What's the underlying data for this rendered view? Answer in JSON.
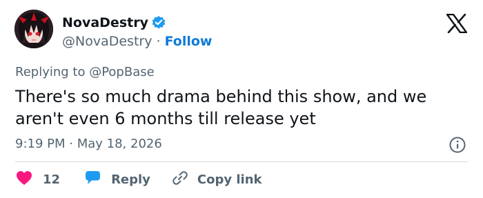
{
  "user": {
    "display_name": "NovaDestry",
    "handle": "@NovaDestry",
    "separator": "·",
    "follow_label": "Follow"
  },
  "tweet": {
    "replying_to": "Replying to @PopBase",
    "text_lines": [
      "There's so much drama behind this show, and we",
      "aren't even 6 months till release yet"
    ],
    "time": "9:19 PM",
    "date_separator": "·",
    "date": "May 18, 2026"
  },
  "actions": {
    "like_count": "12",
    "reply_label": "Reply",
    "copy_label": "Copy link"
  },
  "icons": {
    "verified": "verified-badge-icon",
    "logo": "x-logo-icon",
    "info": "info-icon",
    "like": "heart-icon",
    "reply": "speech-bubble-icon",
    "copy": "link-icon"
  },
  "colors": {
    "follow": "#0f7ad8",
    "verified": "#1d9bf0",
    "heart": "#f91880",
    "reply_bubble": "#1d9bf0",
    "muted_text": "#536471",
    "main_text": "#0f1419",
    "divider": "#cfd9de"
  }
}
